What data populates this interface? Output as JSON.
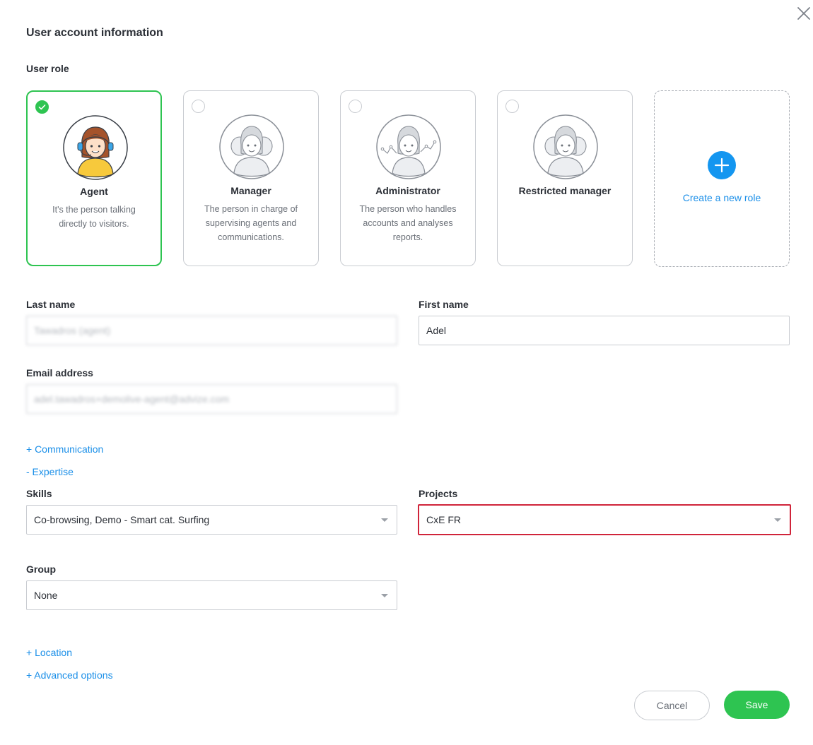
{
  "header": {
    "title": "User account information",
    "close_icon": "close-icon"
  },
  "user_role": {
    "label": "User role",
    "roles": [
      {
        "name": "Agent",
        "description": "It's the person talking directly to visitors.",
        "selected": true
      },
      {
        "name": "Manager",
        "description": "The person in charge of supervising agents and communications.",
        "selected": false
      },
      {
        "name": "Administrator",
        "description": "The person who handles accounts and analyses reports.",
        "selected": false
      },
      {
        "name": "Restricted manager",
        "description": "",
        "selected": false
      }
    ],
    "create_new_label": "Create a new role"
  },
  "form": {
    "last_name": {
      "label": "Last name",
      "value": "Tawadros (agent)"
    },
    "first_name": {
      "label": "First name",
      "value": "Adel"
    },
    "email": {
      "label": "Email address",
      "value": "adel.tawadros+demolive-agent@advize.com"
    }
  },
  "sections": {
    "communication": "+ Communication",
    "expertise": "- Expertise",
    "location": "+ Location",
    "advanced": "+ Advanced options"
  },
  "expertise": {
    "skills": {
      "label": "Skills",
      "value": "Co-browsing, Demo - Smart cat. Surfing"
    },
    "projects": {
      "label": "Projects",
      "value": "CxE FR"
    },
    "group": {
      "label": "Group",
      "value": "None"
    }
  },
  "actions": {
    "cancel": "Cancel",
    "save": "Save"
  },
  "colors": {
    "selected_border": "#2ec451",
    "link": "#1b8fe8",
    "highlight_border": "#d0243a",
    "save_button": "#2ec451"
  }
}
